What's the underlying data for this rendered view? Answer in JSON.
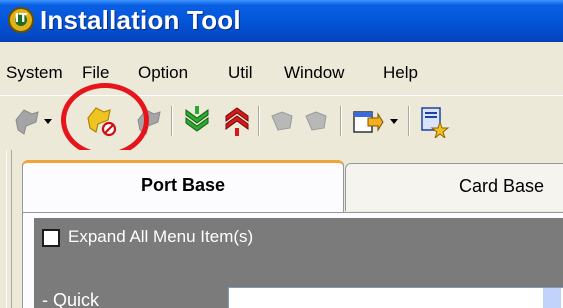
{
  "window": {
    "title": "Installation Tool",
    "icon": "app-logo-icon",
    "icon_letter": "IT"
  },
  "menu": {
    "items": [
      "System",
      "File",
      "Option",
      "Util",
      "Window",
      "Help"
    ]
  },
  "toolbar": {
    "buttons": [
      {
        "icon": "connect-icon",
        "enabled": false
      },
      {
        "icon": "dropdown-arrow-icon",
        "enabled": true
      },
      {
        "icon": "disconnect-icon",
        "enabled": true,
        "highlighted": true
      },
      {
        "icon": "refresh-icon",
        "enabled": false
      },
      {
        "icon": "download-icon",
        "enabled": true
      },
      {
        "icon": "upload-icon",
        "enabled": true
      },
      {
        "icon": "pause-icon",
        "enabled": false
      },
      {
        "icon": "resume-icon",
        "enabled": false
      },
      {
        "icon": "export-icon",
        "enabled": true
      },
      {
        "icon": "report-icon",
        "enabled": true
      }
    ],
    "highlight_color": "#e8141c"
  },
  "tabs": {
    "items": [
      {
        "label": "Port Base",
        "active": true
      },
      {
        "label": "Card Base",
        "active": false
      }
    ]
  },
  "panel": {
    "expand_all_label": "Expand All Menu Item(s)",
    "expand_all_checked": false,
    "quick_label": "- Quick"
  }
}
